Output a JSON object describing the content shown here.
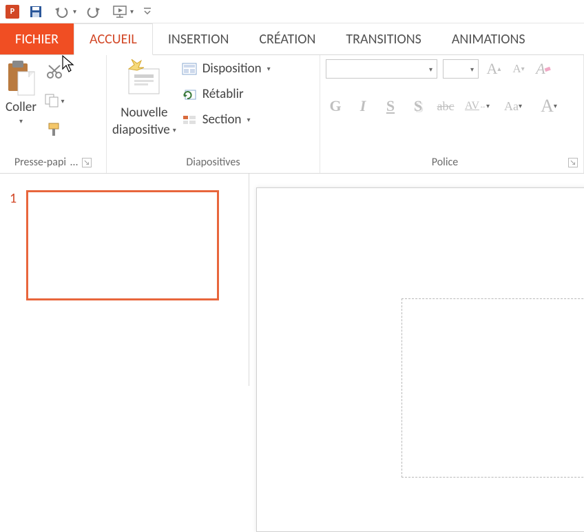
{
  "qat": {
    "app_letter": "P"
  },
  "tabs": {
    "file": "FICHIER",
    "home": "ACCUEIL",
    "insert": "INSERTION",
    "design": "CRÉATION",
    "transitions": "TRANSITIONS",
    "animations": "ANIMATIONS"
  },
  "ribbon": {
    "clipboard": {
      "paste": "Coller",
      "group_label": "Presse-papi"
    },
    "slides": {
      "new_slide_line1": "Nouvelle",
      "new_slide_line2": "diapositive",
      "layout": "Disposition",
      "reset": "Rétablir",
      "section": "Section",
      "group_label": "Diapositives"
    },
    "font": {
      "group_label": "Police",
      "bold": "G",
      "italic": "I",
      "underline": "S",
      "shadow": "S",
      "strike": "abc",
      "spacing": "AV",
      "case": "Aa",
      "bigA": "A",
      "incA": "A",
      "decA": "A",
      "clear": "A"
    }
  },
  "thumbs": {
    "first_index": "1"
  }
}
